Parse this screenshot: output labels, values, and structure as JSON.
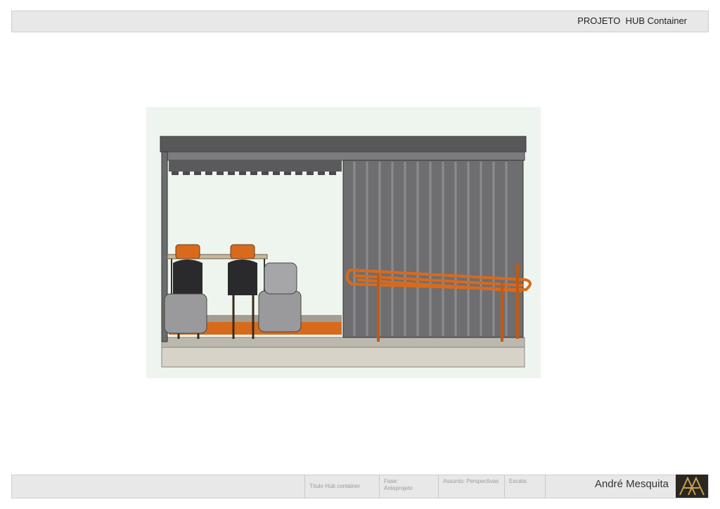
{
  "header": {
    "title": "PROJETO  HUB Container"
  },
  "drawing": {
    "alt": "HUB container perspective view"
  },
  "footer": {
    "title_label": "Título Hub container",
    "phase_label": "Fase:",
    "phase_value": "Anteprojeto",
    "subject_label": "Assunto: Perspectivas",
    "scale_label": "Escala:",
    "author": "André Mesquita",
    "logo_icon": "am-monogram-logo"
  },
  "colors": {
    "bar": "#e8e8e8",
    "container": "#6e6e70",
    "accent_orange": "#d86a1c",
    "background_panel": "#eef5ef"
  }
}
